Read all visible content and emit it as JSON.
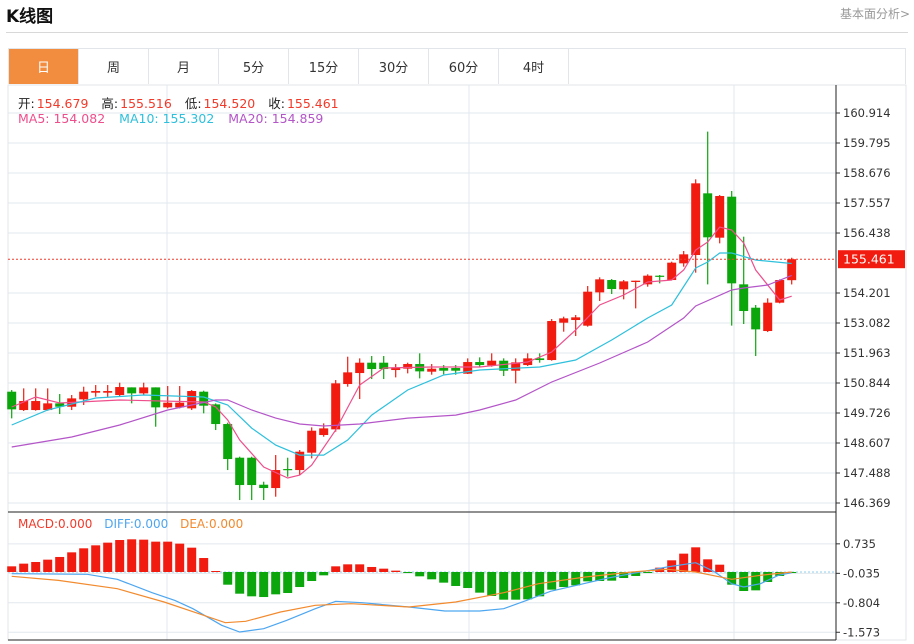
{
  "header": {
    "title": "K线图",
    "link": "基本面分析>"
  },
  "tabs": [
    {
      "label": "日",
      "active": true
    },
    {
      "label": "周"
    },
    {
      "label": "月"
    },
    {
      "label": "5分"
    },
    {
      "label": "15分"
    },
    {
      "label": "30分"
    },
    {
      "label": "60分"
    },
    {
      "label": "4时"
    }
  ],
  "info": {
    "open_label": "开:",
    "open": "154.679",
    "high_label": "高:",
    "high": "155.516",
    "low_label": "低:",
    "low": "154.520",
    "close_label": "收:",
    "close": "155.461",
    "ma5": "MA5: 154.082",
    "ma10": "MA10: 155.302",
    "ma20": "MA20: 154.859"
  },
  "macd_info": {
    "macd": "MACD:0.000",
    "diff": "DIFF:0.000",
    "dea": "DEA:0.000"
  },
  "colors": {
    "up": "#f21b0f",
    "down": "#0ba60b",
    "ma5": "#ee4f8c",
    "ma10": "#2ec0dc",
    "ma20": "#b455c8",
    "diff": "#4da6f0",
    "dea": "#f28a2e",
    "accent": "#f28c3f"
  },
  "chart_data": [
    {
      "type": "candlestick",
      "title": "K线图",
      "price_ticks": [
        "160.914",
        "159.795",
        "158.676",
        "157.557",
        "156.438",
        "154.201",
        "153.082",
        "151.963",
        "150.844",
        "149.726",
        "148.607",
        "147.488",
        "146.369"
      ],
      "ylim": [
        146.369,
        160.914
      ],
      "last_price": "155.461",
      "ohlc": [
        [
          150.52,
          150.582,
          149.525,
          149.861
        ],
        [
          149.836,
          150.644,
          149.799,
          150.172
        ],
        [
          149.836,
          150.644,
          149.811,
          150.172
        ],
        [
          149.836,
          150.644,
          149.811,
          150.085
        ],
        [
          150.085,
          150.433,
          149.687,
          149.96
        ],
        [
          149.96,
          150.396,
          149.836,
          150.271
        ],
        [
          150.234,
          150.706,
          150.023,
          150.52
        ],
        [
          150.483,
          150.768,
          150.333,
          150.545
        ],
        [
          150.483,
          150.768,
          150.309,
          150.545
        ],
        [
          150.396,
          150.856,
          150.333,
          150.694
        ],
        [
          150.681,
          150.681,
          150.085,
          150.458
        ],
        [
          150.458,
          150.856,
          150.396,
          150.681
        ],
        [
          150.681,
          150.681,
          149.214,
          149.936
        ],
        [
          149.936,
          150.731,
          149.898,
          150.11
        ],
        [
          149.936,
          150.731,
          149.898,
          150.11
        ],
        [
          149.898,
          150.582,
          149.836,
          150.545
        ],
        [
          150.52,
          150.557,
          149.712,
          149.998
        ],
        [
          150.047,
          150.085,
          149.09,
          149.314
        ],
        [
          149.314,
          149.364,
          147.598,
          148.008
        ],
        [
          148.058,
          148.096,
          146.479,
          147.039
        ],
        [
          148.058,
          148.096,
          146.479,
          147.039
        ],
        [
          147.051,
          147.163,
          146.479,
          146.927
        ],
        [
          146.927,
          148.158,
          146.604,
          147.598
        ],
        [
          147.636,
          148.058,
          147.35,
          147.598
        ],
        [
          147.598,
          148.344,
          147.411,
          148.282
        ],
        [
          148.245,
          149.19,
          148.033,
          149.065
        ],
        [
          148.904,
          149.339,
          148.841,
          149.152
        ],
        [
          149.115,
          150.955,
          149.028,
          150.831
        ],
        [
          150.806,
          151.825,
          150.706,
          151.241
        ],
        [
          151.216,
          151.763,
          150.246,
          151.602
        ],
        [
          151.602,
          151.85,
          150.992,
          151.365
        ],
        [
          151.602,
          151.85,
          150.992,
          151.365
        ],
        [
          151.328,
          151.552,
          151.054,
          151.427
        ],
        [
          151.378,
          151.602,
          151.204,
          151.552
        ],
        [
          151.552,
          151.95,
          151.017,
          151.278
        ],
        [
          151.266,
          151.552,
          151.154,
          151.378
        ],
        [
          151.403,
          151.514,
          151.166,
          151.303
        ],
        [
          151.403,
          151.514,
          151.154,
          151.303
        ],
        [
          151.191,
          151.763,
          151.179,
          151.626
        ],
        [
          151.626,
          151.8,
          151.452,
          151.514
        ],
        [
          151.502,
          151.95,
          151.452,
          151.676
        ],
        [
          151.676,
          151.763,
          151.104,
          151.303
        ],
        [
          151.303,
          151.763,
          150.831,
          151.614
        ],
        [
          151.514,
          151.95,
          151.477,
          151.763
        ],
        [
          151.763,
          151.95,
          151.602,
          151.701
        ],
        [
          151.701,
          153.23,
          151.676,
          153.156
        ],
        [
          153.094,
          153.318,
          152.758,
          153.255
        ],
        [
          153.193,
          153.38,
          152.596,
          153.293
        ],
        [
          152.982,
          154.461,
          152.945,
          154.25
        ],
        [
          154.225,
          154.785,
          153.902,
          154.71
        ],
        [
          154.685,
          154.722,
          154.163,
          154.349
        ],
        [
          154.337,
          154.685,
          153.964,
          154.635
        ],
        [
          154.611,
          154.66,
          153.628,
          154.66
        ],
        [
          154.524,
          154.897,
          154.436,
          154.847
        ],
        [
          154.847,
          154.872,
          154.561,
          154.81
        ],
        [
          154.685,
          155.369,
          154.685,
          155.332
        ],
        [
          155.307,
          155.767,
          155.182,
          155.643
        ],
        [
          155.618,
          158.44,
          154.959,
          158.291
        ],
        [
          157.918,
          160.218,
          154.524,
          156.277
        ],
        [
          156.264,
          157.856,
          156.053,
          157.818
        ],
        [
          157.793,
          158.005,
          152.982,
          154.561
        ],
        [
          154.524,
          156.301,
          153.044,
          153.529
        ],
        [
          153.653,
          153.753,
          151.85,
          152.845
        ],
        [
          152.783,
          154.001,
          152.745,
          153.84
        ],
        [
          153.84,
          154.71,
          153.815,
          154.685
        ],
        [
          154.679,
          155.516,
          154.52,
          155.461
        ]
      ],
      "ma": {
        "MA5": [
          [
            1,
            149.948
          ],
          [
            3,
            150.321
          ],
          [
            5,
            150.097
          ],
          [
            10,
            150.209
          ],
          [
            17,
            150.134
          ],
          [
            18,
            149.948
          ],
          [
            19,
            149.463
          ],
          [
            20,
            148.717
          ],
          [
            22,
            147.71
          ],
          [
            24,
            147.3
          ],
          [
            25,
            147.411
          ],
          [
            26,
            147.784
          ],
          [
            28,
            149.09
          ],
          [
            30,
            150.768
          ],
          [
            32,
            151.403
          ],
          [
            36,
            151.44
          ],
          [
            40,
            151.44
          ],
          [
            44,
            151.627
          ],
          [
            46,
            152.0
          ],
          [
            48,
            152.82
          ],
          [
            50,
            153.752
          ],
          [
            52,
            154.125
          ],
          [
            54,
            154.61
          ],
          [
            56,
            154.685
          ],
          [
            57,
            155.058
          ],
          [
            58,
            155.804
          ],
          [
            59,
            156.102
          ],
          [
            60,
            156.662
          ],
          [
            61,
            156.55
          ],
          [
            62,
            156.065
          ],
          [
            63,
            155.058
          ],
          [
            65,
            153.939
          ],
          [
            66,
            154.082
          ]
        ],
        "MA10": [
          [
            1,
            149.277
          ],
          [
            4,
            149.836
          ],
          [
            8,
            150.284
          ],
          [
            12,
            150.395
          ],
          [
            17,
            150.321
          ],
          [
            19,
            150.022
          ],
          [
            21,
            149.164
          ],
          [
            23,
            148.53
          ],
          [
            25,
            148.157
          ],
          [
            27,
            148.157
          ],
          [
            29,
            148.717
          ],
          [
            31,
            149.649
          ],
          [
            34,
            150.582
          ],
          [
            37,
            151.141
          ],
          [
            40,
            151.328
          ],
          [
            45,
            151.44
          ],
          [
            48,
            151.701
          ],
          [
            51,
            152.447
          ],
          [
            54,
            153.268
          ],
          [
            56,
            153.752
          ],
          [
            58,
            155.133
          ],
          [
            59,
            155.356
          ],
          [
            60,
            155.692
          ],
          [
            61,
            155.692
          ],
          [
            63,
            155.431
          ],
          [
            66,
            155.302
          ]
        ],
        "MA20": [
          [
            1,
            148.456
          ],
          [
            6,
            148.829
          ],
          [
            10,
            149.277
          ],
          [
            14,
            149.836
          ],
          [
            18,
            150.209
          ],
          [
            19,
            150.209
          ],
          [
            21,
            149.836
          ],
          [
            23,
            149.537
          ],
          [
            25,
            149.314
          ],
          [
            27,
            149.239
          ],
          [
            30,
            149.314
          ],
          [
            34,
            149.537
          ],
          [
            38,
            149.649
          ],
          [
            40,
            149.836
          ],
          [
            43,
            150.209
          ],
          [
            46,
            150.88
          ],
          [
            50,
            151.589
          ],
          [
            54,
            152.372
          ],
          [
            57,
            153.268
          ],
          [
            58,
            153.715
          ],
          [
            61,
            154.312
          ],
          [
            62,
            154.386
          ],
          [
            64,
            154.498
          ],
          [
            66,
            154.859
          ]
        ]
      }
    },
    {
      "type": "macd",
      "ticks": [
        "0.735",
        "-0.035",
        "-0.804",
        "-1.573"
      ],
      "histogram": [
        0.148,
        0.218,
        0.261,
        0.322,
        0.392,
        0.513,
        0.618,
        0.696,
        0.766,
        0.835,
        0.853,
        0.844,
        0.792,
        0.792,
        0.74,
        0.635,
        0.365,
        0.026,
        -0.331,
        -0.566,
        -0.635,
        -0.653,
        -0.583,
        -0.548,
        -0.392,
        -0.235,
        -0.087,
        0.148,
        0.2,
        0.2,
        0.131,
        0.087,
        0.035,
        -0.009,
        -0.113,
        -0.191,
        -0.278,
        -0.365,
        -0.418,
        -0.539,
        -0.626,
        -0.722,
        -0.722,
        -0.713,
        -0.635,
        -0.461,
        -0.392,
        -0.348,
        -0.244,
        -0.235,
        -0.226,
        -0.157,
        -0.104,
        -0.026,
        0.113,
        0.305,
        0.479,
        0.644,
        0.331,
        0.191,
        -0.331,
        -0.496,
        -0.479,
        -0.261,
        -0.104,
        -0.026
      ],
      "diff": [
        [
          1,
          -0.044
        ],
        [
          7.3,
          -0.061
        ],
        [
          9.8,
          -0.191
        ],
        [
          12.7,
          -0.539
        ],
        [
          14.6,
          -0.74
        ],
        [
          16.1,
          -0.957
        ],
        [
          18.5,
          -1.392
        ],
        [
          20,
          -1.566
        ],
        [
          22,
          -1.479
        ],
        [
          23.9,
          -1.262
        ],
        [
          26.3,
          -0.957
        ],
        [
          28,
          -0.766
        ],
        [
          30.2,
          -0.8
        ],
        [
          34.1,
          -0.914
        ],
        [
          37.1,
          -1.018
        ],
        [
          40,
          -1.018
        ],
        [
          42,
          -0.957
        ],
        [
          43.9,
          -0.74
        ],
        [
          45.9,
          -0.505
        ],
        [
          48.3,
          -0.331
        ],
        [
          50.7,
          -0.157
        ],
        [
          53.7,
          0.017
        ],
        [
          55.6,
          0.131
        ],
        [
          58,
          0.244
        ],
        [
          59.5,
          0.017
        ],
        [
          61,
          -0.305
        ],
        [
          62,
          -0.392
        ],
        [
          63.4,
          -0.305
        ],
        [
          64.9,
          -0.087
        ],
        [
          66,
          -0.017
        ]
      ],
      "dea": [
        [
          1,
          -0.113
        ],
        [
          4.9,
          -0.218
        ],
        [
          9.8,
          -0.435
        ],
        [
          13.7,
          -0.783
        ],
        [
          16.6,
          -1.088
        ],
        [
          18.8,
          -1.322
        ],
        [
          20.5,
          -1.288
        ],
        [
          23.4,
          -1.044
        ],
        [
          26.3,
          -0.87
        ],
        [
          29.3,
          -0.827
        ],
        [
          34.1,
          -0.914
        ],
        [
          38,
          -0.783
        ],
        [
          42,
          -0.539
        ],
        [
          44.9,
          -0.305
        ],
        [
          48.8,
          -0.131
        ],
        [
          52.7,
          0
        ],
        [
          55.6,
          0.07
        ],
        [
          58,
          0
        ],
        [
          61,
          -0.191
        ],
        [
          63.4,
          -0.087
        ],
        [
          66,
          0
        ]
      ]
    }
  ]
}
